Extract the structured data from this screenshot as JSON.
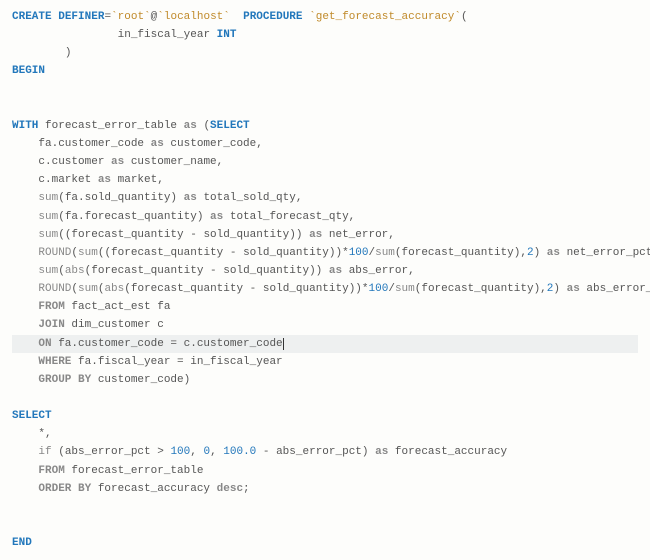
{
  "code": {
    "l1": {
      "create": "CREATE",
      "definer": "DEFINER",
      "eq": "=",
      "bt1": "`root`",
      "at": "@",
      "bt2": "`localhost`",
      "sp": "  ",
      "procedure": "PROCEDURE",
      "sp2": " ",
      "bt3": "`get_forecast_accuracy`",
      "paren": "("
    },
    "l2": {
      "indent": "                ",
      "param": "in_fiscal_year ",
      "type": "INT"
    },
    "l3": {
      "indent": "        ",
      "paren": ")"
    },
    "l4": {
      "begin": "BEGIN"
    },
    "l5": "",
    "l6": "",
    "l7": {
      "with": "WITH",
      "sp": " ",
      "tbl": "forecast_error_table ",
      "as": "as",
      "sp2": " (",
      "select": "SELECT"
    },
    "l8": {
      "indent": "    ",
      "lhs": "fa.customer_code ",
      "as": "as",
      "rhs": " customer_code,"
    },
    "l9": {
      "indent": "    ",
      "lhs": "c.customer ",
      "as": "as",
      "rhs": " customer_name,"
    },
    "l10": {
      "indent": "    ",
      "lhs": "c.market ",
      "as": "as",
      "rhs": " market,"
    },
    "l11": {
      "indent": "    ",
      "fn": "sum",
      "args": "(fa.sold_quantity) ",
      "as": "as",
      "rhs": " total_sold_qty,"
    },
    "l12": {
      "indent": "    ",
      "fn": "sum",
      "args": "(fa.forecast_quantity) ",
      "as": "as",
      "rhs": " total_forecast_qty,"
    },
    "l13": {
      "indent": "    ",
      "fn": "sum",
      "args": "((forecast_quantity - sold_quantity)) ",
      "as": "as",
      "rhs": " net_error,"
    },
    "l14": {
      "indent": "    ",
      "fn1": "ROUND",
      "p1": "(",
      "fn2": "sum",
      "args1": "((forecast_quantity - sold_quantity))*",
      "n1": "100",
      "slash": "/",
      "fn3": "sum",
      "args2": "(forecast_quantity),",
      "n2": "2",
      "p2": ") ",
      "as": "as",
      "rhs": " net_error_pct,"
    },
    "l15": {
      "indent": "    ",
      "fn1": "sum",
      "p1": "(",
      "fn2": "abs",
      "args": "(forecast_quantity - sold_quantity)) ",
      "as": "as",
      "rhs": " abs_error,"
    },
    "l16": {
      "indent": "    ",
      "fn1": "ROUND",
      "p1": "(",
      "fn2": "sum",
      "p2": "(",
      "fn3": "abs",
      "args1": "(forecast_quantity - sold_quantity))*",
      "n1": "100",
      "slash": "/",
      "fn4": "sum",
      "args2": "(forecast_quantity),",
      "n2": "2",
      "p3": ") ",
      "as": "as",
      "rhs": " abs_error_pct"
    },
    "l17": {
      "indent": "    ",
      "from": "FROM",
      "rhs": " fact_act_est fa"
    },
    "l18": {
      "indent": "    ",
      "join": "JOIN",
      "rhs": " dim_customer c"
    },
    "l19": {
      "indent": "    ",
      "on": "ON",
      "rhs": " fa.customer_code = c.customer_code"
    },
    "l20": {
      "indent": "    ",
      "where": "WHERE",
      "rhs": " fa.fiscal_year = in_fiscal_year"
    },
    "l21": {
      "indent": "    ",
      "group": "GROUP BY",
      "rhs": " customer_code)"
    },
    "l22": "",
    "l23": {
      "select": "SELECT"
    },
    "l24": {
      "indent": "    ",
      "star": "*,"
    },
    "l25": {
      "indent": "    ",
      "fn": "if",
      "sp": " ",
      "args1": "(abs_error_pct > ",
      "n1": "100",
      "c1": ", ",
      "n2": "0",
      "c2": ", ",
      "n3": "100.0",
      "args2": " - abs_error_pct) ",
      "as": "as",
      "rhs": " forecast_accuracy"
    },
    "l26": {
      "indent": "    ",
      "from": "FROM",
      "rhs": " forecast_error_table"
    },
    "l27": {
      "indent": "    ",
      "order": "ORDER BY",
      "mid": " forecast_accuracy ",
      "desc": "desc",
      "semi": ";"
    },
    "l28": "",
    "l29": "",
    "l30": {
      "end": "END"
    }
  }
}
